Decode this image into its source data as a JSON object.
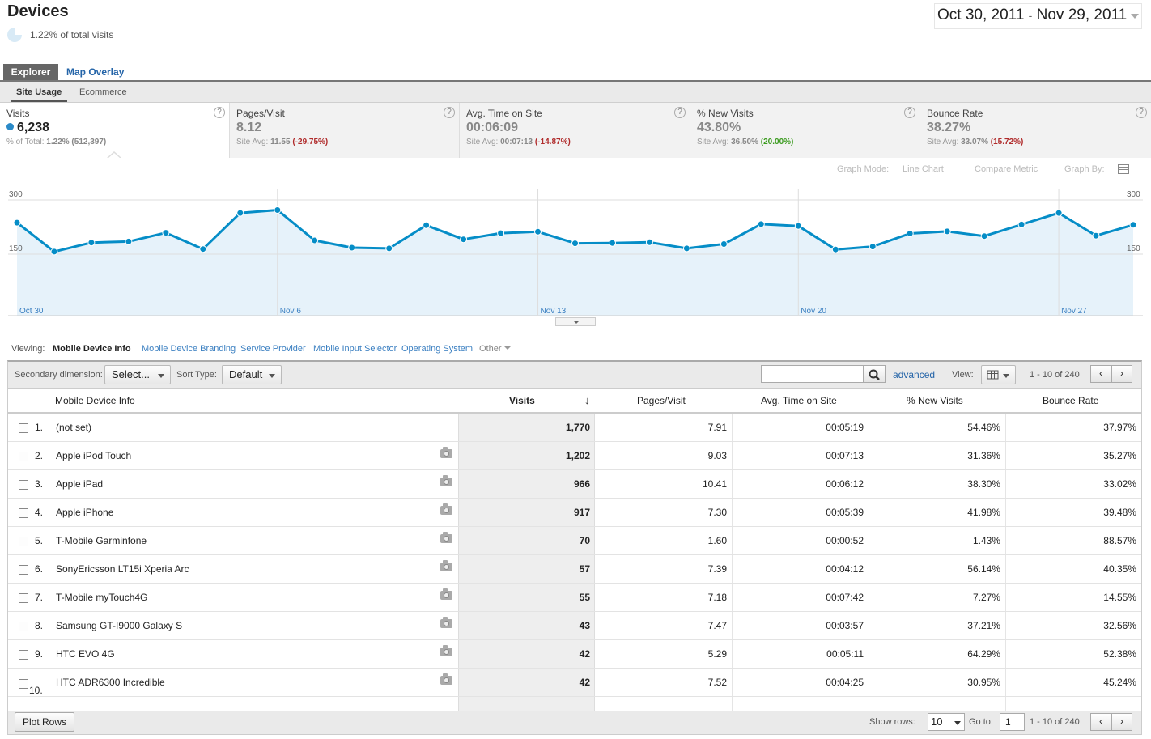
{
  "header": {
    "title": "Devices",
    "pct_of_total": "1.22% of total visits",
    "date_start": "Oct 30, 2011",
    "date_sep": "-",
    "date_end": "Nov 29, 2011"
  },
  "tabs": {
    "explorer": "Explorer",
    "map_overlay": "Map Overlay"
  },
  "subtabs": {
    "site_usage": "Site Usage",
    "ecommerce": "Ecommerce"
  },
  "metrics": [
    {
      "label": "Visits",
      "value": "6,238",
      "avg_prefix": "% of Total:",
      "avg_value": "1.22% (512,397)",
      "delta": ""
    },
    {
      "label": "Pages/Visit",
      "value": "8.12",
      "avg_prefix": "Site Avg:",
      "avg_value": "11.55",
      "delta": "(-29.75%)"
    },
    {
      "label": "Avg. Time on Site",
      "value": "00:06:09",
      "avg_prefix": "Site Avg:",
      "avg_value": "00:07:13",
      "delta": "(-14.87%)"
    },
    {
      "label": "% New Visits",
      "value": "43.80%",
      "avg_prefix": "Site Avg:",
      "avg_value": "36.50%",
      "delta": "(20.00%)"
    },
    {
      "label": "Bounce Rate",
      "value": "38.27%",
      "avg_prefix": "Site Avg:",
      "avg_value": "33.07%",
      "delta": "(15.72%)"
    }
  ],
  "help_glyph": "?",
  "graph_controls": {
    "graph_mode_label": "Graph Mode:",
    "graph_mode_value": "Line Chart",
    "compare_metric": "Compare Metric",
    "graph_by": "Graph By:"
  },
  "chart_data": {
    "type": "area",
    "series": [
      {
        "values": [
          237,
          157,
          182,
          185,
          209,
          164,
          264,
          272,
          188,
          168,
          166,
          230,
          191,
          208,
          212,
          180,
          181,
          183,
          166,
          178,
          233,
          228,
          163,
          171,
          207,
          213,
          200,
          232,
          264,
          201,
          231
        ]
      }
    ],
    "x_tick_labels": [
      "Oct 30",
      "Nov 6",
      "Nov 13",
      "Nov 20",
      "Nov 27"
    ],
    "x_tick_indices": [
      0,
      7,
      14,
      21,
      28
    ],
    "y_tick_labels": [
      "300",
      "150"
    ],
    "y_ticks": [
      300,
      150
    ],
    "ylim": [
      25,
      315
    ],
    "colors": {
      "line": "#058dc7",
      "fill": "#e6f2fa",
      "grid": "#dddddd",
      "tick_text": "#3a7fc1"
    }
  },
  "viewing": {
    "label": "Viewing:",
    "active": "Mobile Device Info",
    "links": [
      "Mobile Device Branding",
      "Service Provider",
      "Mobile Input Selector",
      "Operating System"
    ],
    "other": "Other"
  },
  "toolbar": {
    "secondary_label": "Secondary dimension:",
    "secondary_value": "Select...",
    "sort_label": "Sort Type:",
    "sort_value": "Default",
    "search_value": "",
    "advanced": "advanced",
    "view_label": "View:",
    "pager_text": "1 - 10 of 240",
    "prev": "‹",
    "next": "›"
  },
  "table": {
    "columns": [
      "Mobile Device Info",
      "Visits",
      "Pages/Visit",
      "Avg. Time on Site",
      "% New Visits",
      "Bounce Rate"
    ],
    "sort_glyph": "↓",
    "rows": [
      {
        "idx": "1.",
        "name": "(not set)",
        "visits": "1,770",
        "ppv": "7.91",
        "time": "00:05:19",
        "newv": "54.46%",
        "bounce": "37.97%",
        "cam": false
      },
      {
        "idx": "2.",
        "name": "Apple iPod Touch",
        "visits": "1,202",
        "ppv": "9.03",
        "time": "00:07:13",
        "newv": "31.36%",
        "bounce": "35.27%",
        "cam": true
      },
      {
        "idx": "3.",
        "name": "Apple iPad",
        "visits": "966",
        "ppv": "10.41",
        "time": "00:06:12",
        "newv": "38.30%",
        "bounce": "33.02%",
        "cam": true
      },
      {
        "idx": "4.",
        "name": "Apple iPhone",
        "visits": "917",
        "ppv": "7.30",
        "time": "00:05:39",
        "newv": "41.98%",
        "bounce": "39.48%",
        "cam": true
      },
      {
        "idx": "5.",
        "name": "T-Mobile Garminfone",
        "visits": "70",
        "ppv": "1.60",
        "time": "00:00:52",
        "newv": "1.43%",
        "bounce": "88.57%",
        "cam": true
      },
      {
        "idx": "6.",
        "name": "SonyEricsson LT15i Xperia Arc",
        "visits": "57",
        "ppv": "7.39",
        "time": "00:04:12",
        "newv": "56.14%",
        "bounce": "40.35%",
        "cam": true
      },
      {
        "idx": "7.",
        "name": "T-Mobile myTouch4G",
        "visits": "55",
        "ppv": "7.18",
        "time": "00:07:42",
        "newv": "7.27%",
        "bounce": "14.55%",
        "cam": true
      },
      {
        "idx": "8.",
        "name": "Samsung GT-I9000 Galaxy S",
        "visits": "43",
        "ppv": "7.47",
        "time": "00:03:57",
        "newv": "37.21%",
        "bounce": "32.56%",
        "cam": true
      },
      {
        "idx": "9.",
        "name": "HTC EVO 4G",
        "visits": "42",
        "ppv": "5.29",
        "time": "00:05:11",
        "newv": "64.29%",
        "bounce": "52.38%",
        "cam": true
      },
      {
        "idx": "10.",
        "name": "HTC ADR6300 Incredible",
        "visits": "42",
        "ppv": "7.52",
        "time": "00:04:25",
        "newv": "30.95%",
        "bounce": "45.24%",
        "cam": true
      }
    ]
  },
  "footer": {
    "plot_rows": "Plot Rows",
    "show_rows_label": "Show rows:",
    "show_rows_value": "10",
    "goto_label": "Go to:",
    "goto_value": "1",
    "pager_text": "1 - 10 of 240",
    "prev": "‹",
    "next": "›"
  }
}
